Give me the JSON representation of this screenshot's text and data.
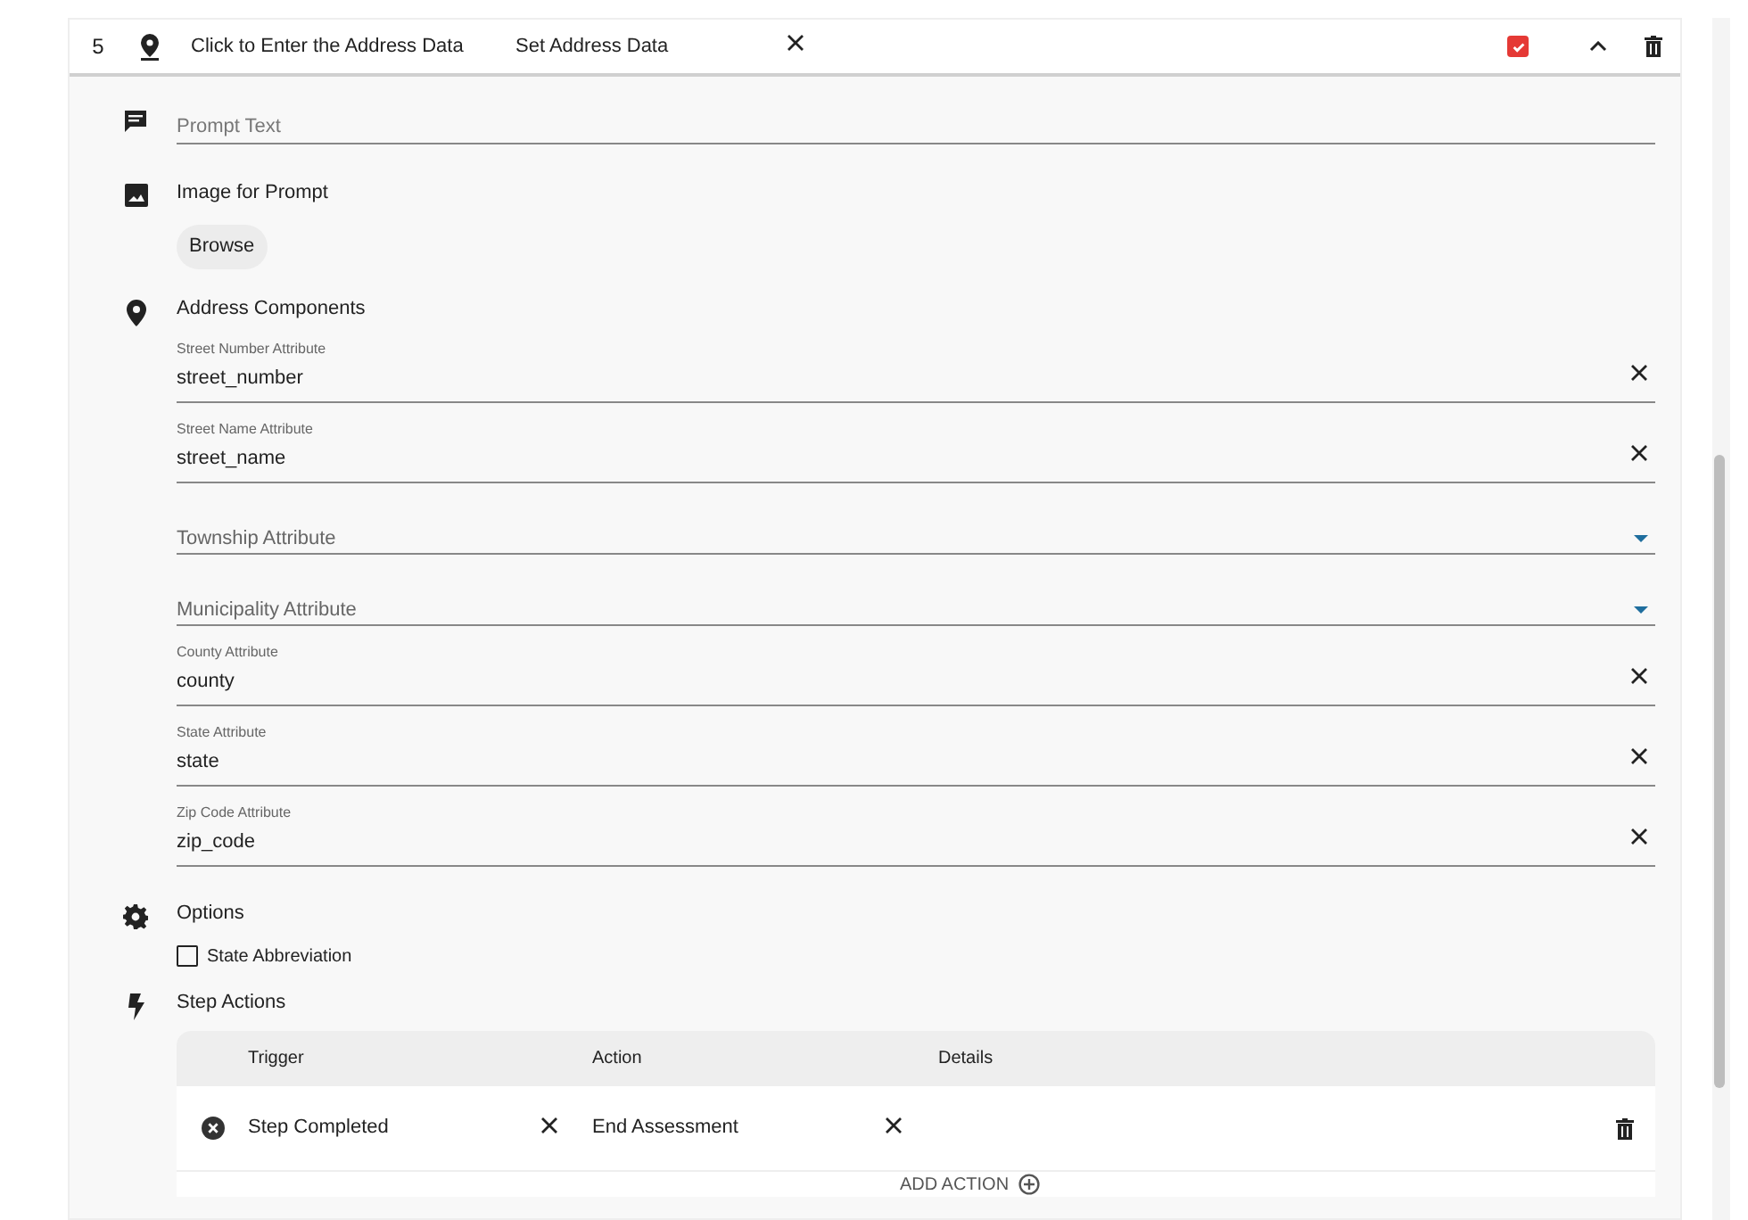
{
  "step": {
    "number": "5",
    "title": "Click to Enter the Address Data",
    "type": "Set Address Data",
    "checked": true,
    "expanded": true
  },
  "prompt_text": {
    "placeholder": "Prompt Text"
  },
  "image_for_prompt": {
    "label": "Image for Prompt",
    "button": "Browse"
  },
  "address_components": {
    "label": "Address Components",
    "fields": [
      {
        "kind": "text",
        "label": "Street Number Attribute",
        "value": "street_number"
      },
      {
        "kind": "text",
        "label": "Street Name Attribute",
        "value": "street_name"
      },
      {
        "kind": "select",
        "placeholder": "Township Attribute"
      },
      {
        "kind": "select",
        "placeholder": "Municipality Attribute"
      },
      {
        "kind": "text",
        "label": "County Attribute",
        "value": "county"
      },
      {
        "kind": "text",
        "label": "State Attribute",
        "value": "state"
      },
      {
        "kind": "text",
        "label": "Zip Code Attribute",
        "value": "zip_code"
      }
    ]
  },
  "options": {
    "label": "Options",
    "items": [
      {
        "label": "State Abbreviation",
        "checked": false
      }
    ]
  },
  "step_actions": {
    "label": "Step Actions",
    "columns": [
      "Trigger",
      "Action",
      "Details"
    ],
    "rows": [
      {
        "trigger": "Step Completed",
        "action": "End Assessment"
      }
    ],
    "add_button": "ADD ACTION"
  }
}
